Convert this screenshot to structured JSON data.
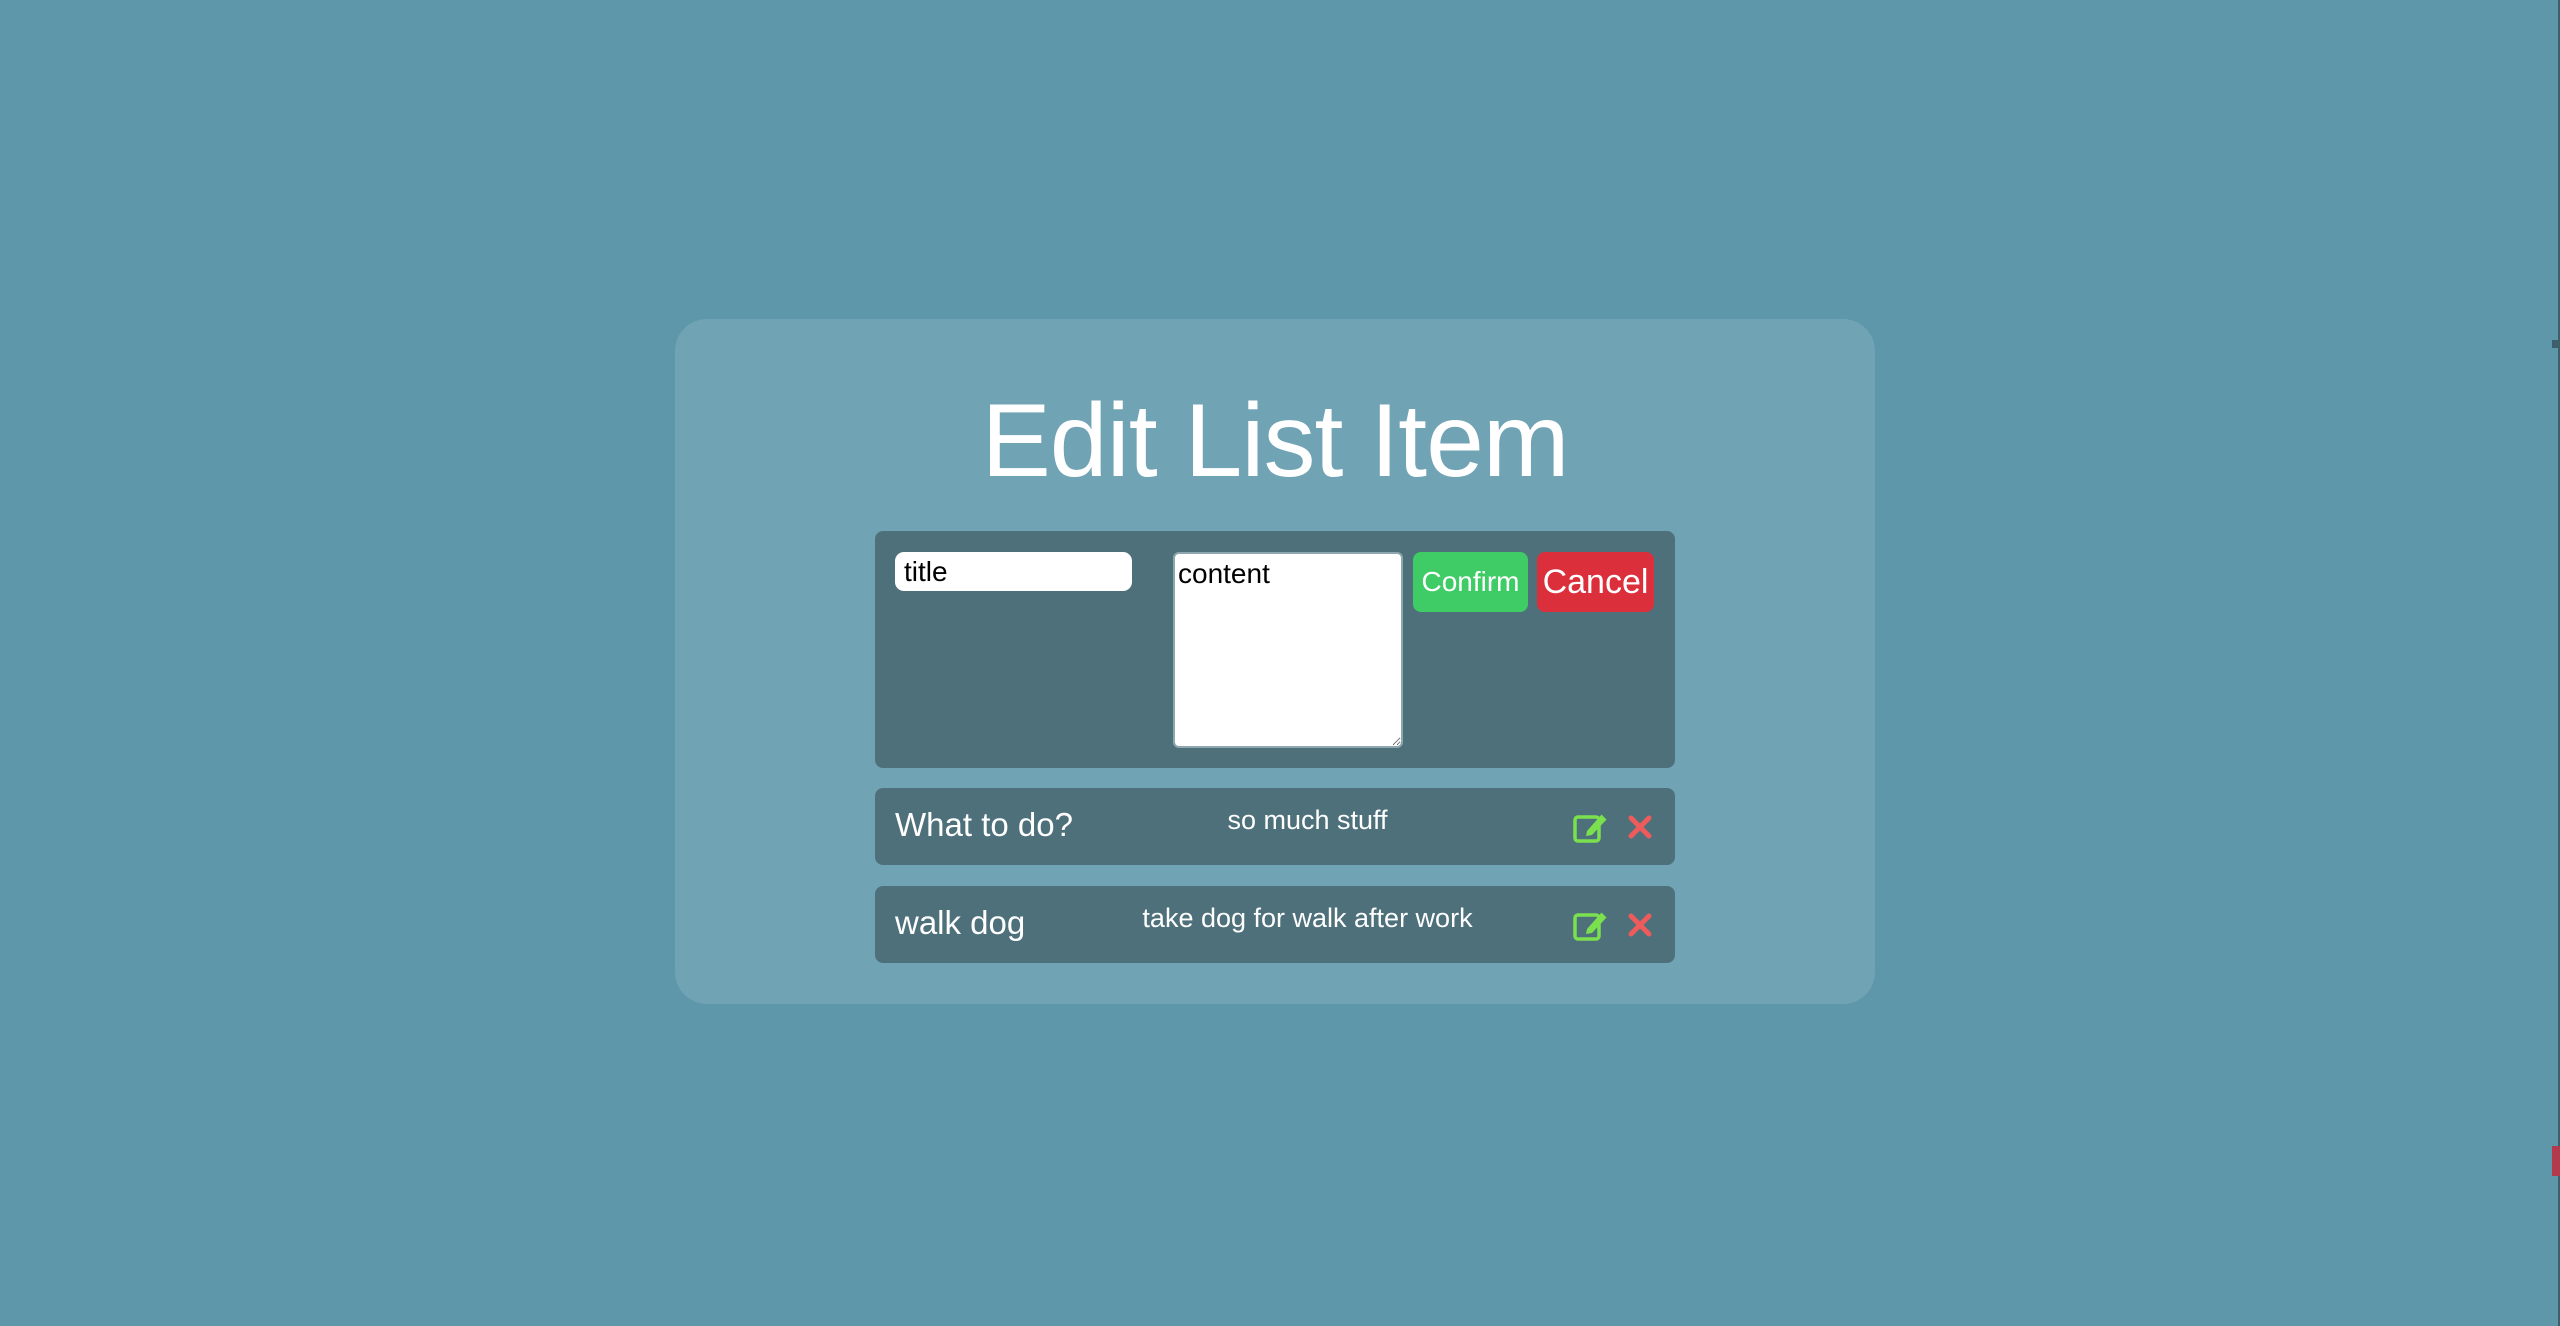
{
  "dialog": {
    "title": "Edit List Item"
  },
  "editor": {
    "title_value": "title",
    "content_value": "content",
    "confirm_label": "Confirm",
    "cancel_label": "Cancel"
  },
  "items": [
    {
      "title": "What to do?",
      "content": "so much stuff"
    },
    {
      "title": "walk dog",
      "content": "take dog for walk after work"
    }
  ],
  "icons": {
    "edit": "edit-icon",
    "delete": "close-icon"
  },
  "colors": {
    "background": "#5e97a9",
    "card": "#70a3b4",
    "panel": "#4e707b",
    "confirm": "#3fcc67",
    "cancel": "#dc2f3c",
    "edit_icon": "#7be04e",
    "delete_icon": "#ef5b5b"
  }
}
